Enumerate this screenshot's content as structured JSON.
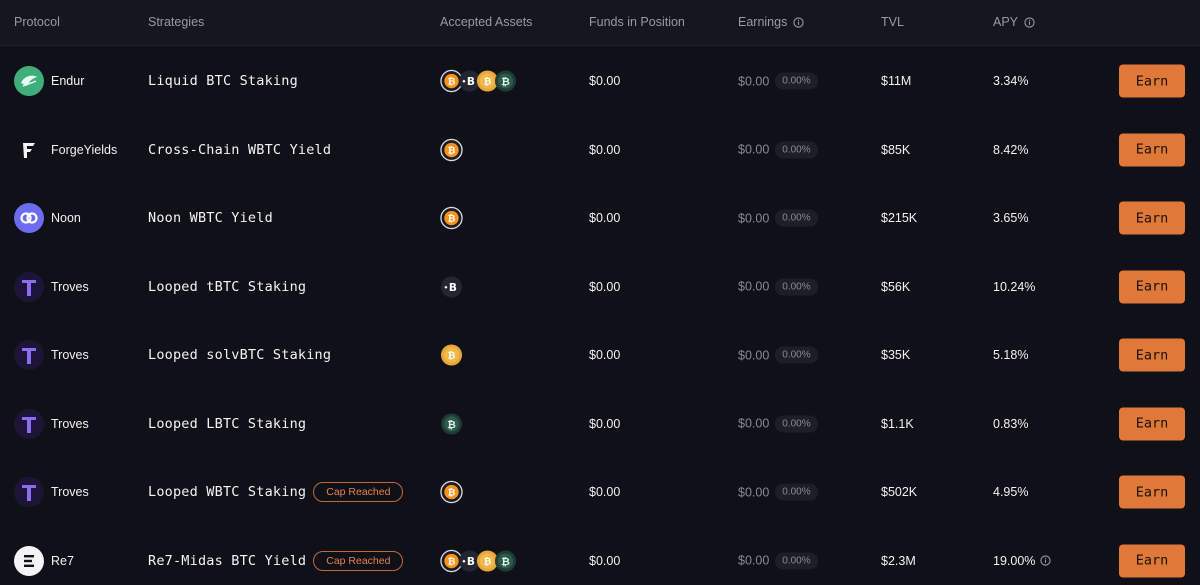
{
  "headers": {
    "protocol": "Protocol",
    "strategies": "Strategies",
    "assets": "Accepted Assets",
    "funds": "Funds in Position",
    "earnings": "Earnings",
    "tvl": "TVL",
    "apy": "APY"
  },
  "earn_label": "Earn",
  "rows": [
    {
      "protocol": "Endur",
      "logo": "endur-logo",
      "strategy": "Liquid BTC Staking",
      "badge": "",
      "assets": [
        "btc-icon",
        "tbtc-icon",
        "solvbtc-icon",
        "lbtc-icon"
      ],
      "funds": "$0.00",
      "earnings": "$0.00",
      "earnings_pct": "0.00%",
      "tvl": "$11M",
      "apy": "3.34%",
      "apy_info": false
    },
    {
      "protocol": "ForgeYields",
      "logo": "forgeyields-logo",
      "strategy": "Cross-Chain WBTC Yield",
      "badge": "",
      "assets": [
        "btc-icon"
      ],
      "funds": "$0.00",
      "earnings": "$0.00",
      "earnings_pct": "0.00%",
      "tvl": "$85K",
      "apy": "8.42%",
      "apy_info": false
    },
    {
      "protocol": "Noon",
      "logo": "noon-logo",
      "strategy": "Noon WBTC Yield",
      "badge": "",
      "assets": [
        "btc-icon"
      ],
      "funds": "$0.00",
      "earnings": "$0.00",
      "earnings_pct": "0.00%",
      "tvl": "$215K",
      "apy": "3.65%",
      "apy_info": false
    },
    {
      "protocol": "Troves",
      "logo": "troves-logo",
      "strategy": "Looped tBTC Staking",
      "badge": "",
      "assets": [
        "tbtc-icon"
      ],
      "funds": "$0.00",
      "earnings": "$0.00",
      "earnings_pct": "0.00%",
      "tvl": "$56K",
      "apy": "10.24%",
      "apy_info": false
    },
    {
      "protocol": "Troves",
      "logo": "troves-logo",
      "strategy": "Looped solvBTC Staking",
      "badge": "",
      "assets": [
        "solvbtc-icon"
      ],
      "funds": "$0.00",
      "earnings": "$0.00",
      "earnings_pct": "0.00%",
      "tvl": "$35K",
      "apy": "5.18%",
      "apy_info": false
    },
    {
      "protocol": "Troves",
      "logo": "troves-logo",
      "strategy": "Looped LBTC Staking",
      "badge": "",
      "assets": [
        "lbtc-icon"
      ],
      "funds": "$0.00",
      "earnings": "$0.00",
      "earnings_pct": "0.00%",
      "tvl": "$1.1K",
      "apy": "0.83%",
      "apy_info": false
    },
    {
      "protocol": "Troves",
      "logo": "troves-logo",
      "strategy": "Looped WBTC Staking",
      "badge": "Cap Reached",
      "assets": [
        "btc-icon"
      ],
      "funds": "$0.00",
      "earnings": "$0.00",
      "earnings_pct": "0.00%",
      "tvl": "$502K",
      "apy": "4.95%",
      "apy_info": false
    },
    {
      "protocol": "Re7",
      "logo": "re7-logo",
      "strategy": "Re7-Midas BTC Yield",
      "badge": "Cap Reached",
      "assets": [
        "btc-icon",
        "tbtc-icon",
        "solvbtc-icon",
        "lbtc-icon"
      ],
      "funds": "$0.00",
      "earnings": "$0.00",
      "earnings_pct": "0.00%",
      "tvl": "$2.3M",
      "apy": "19.00%",
      "apy_info": true
    }
  ],
  "colors": {
    "background": "#101018",
    "header_bg": "#16161e",
    "accent": "#e07839",
    "muted": "#8a8a96"
  }
}
